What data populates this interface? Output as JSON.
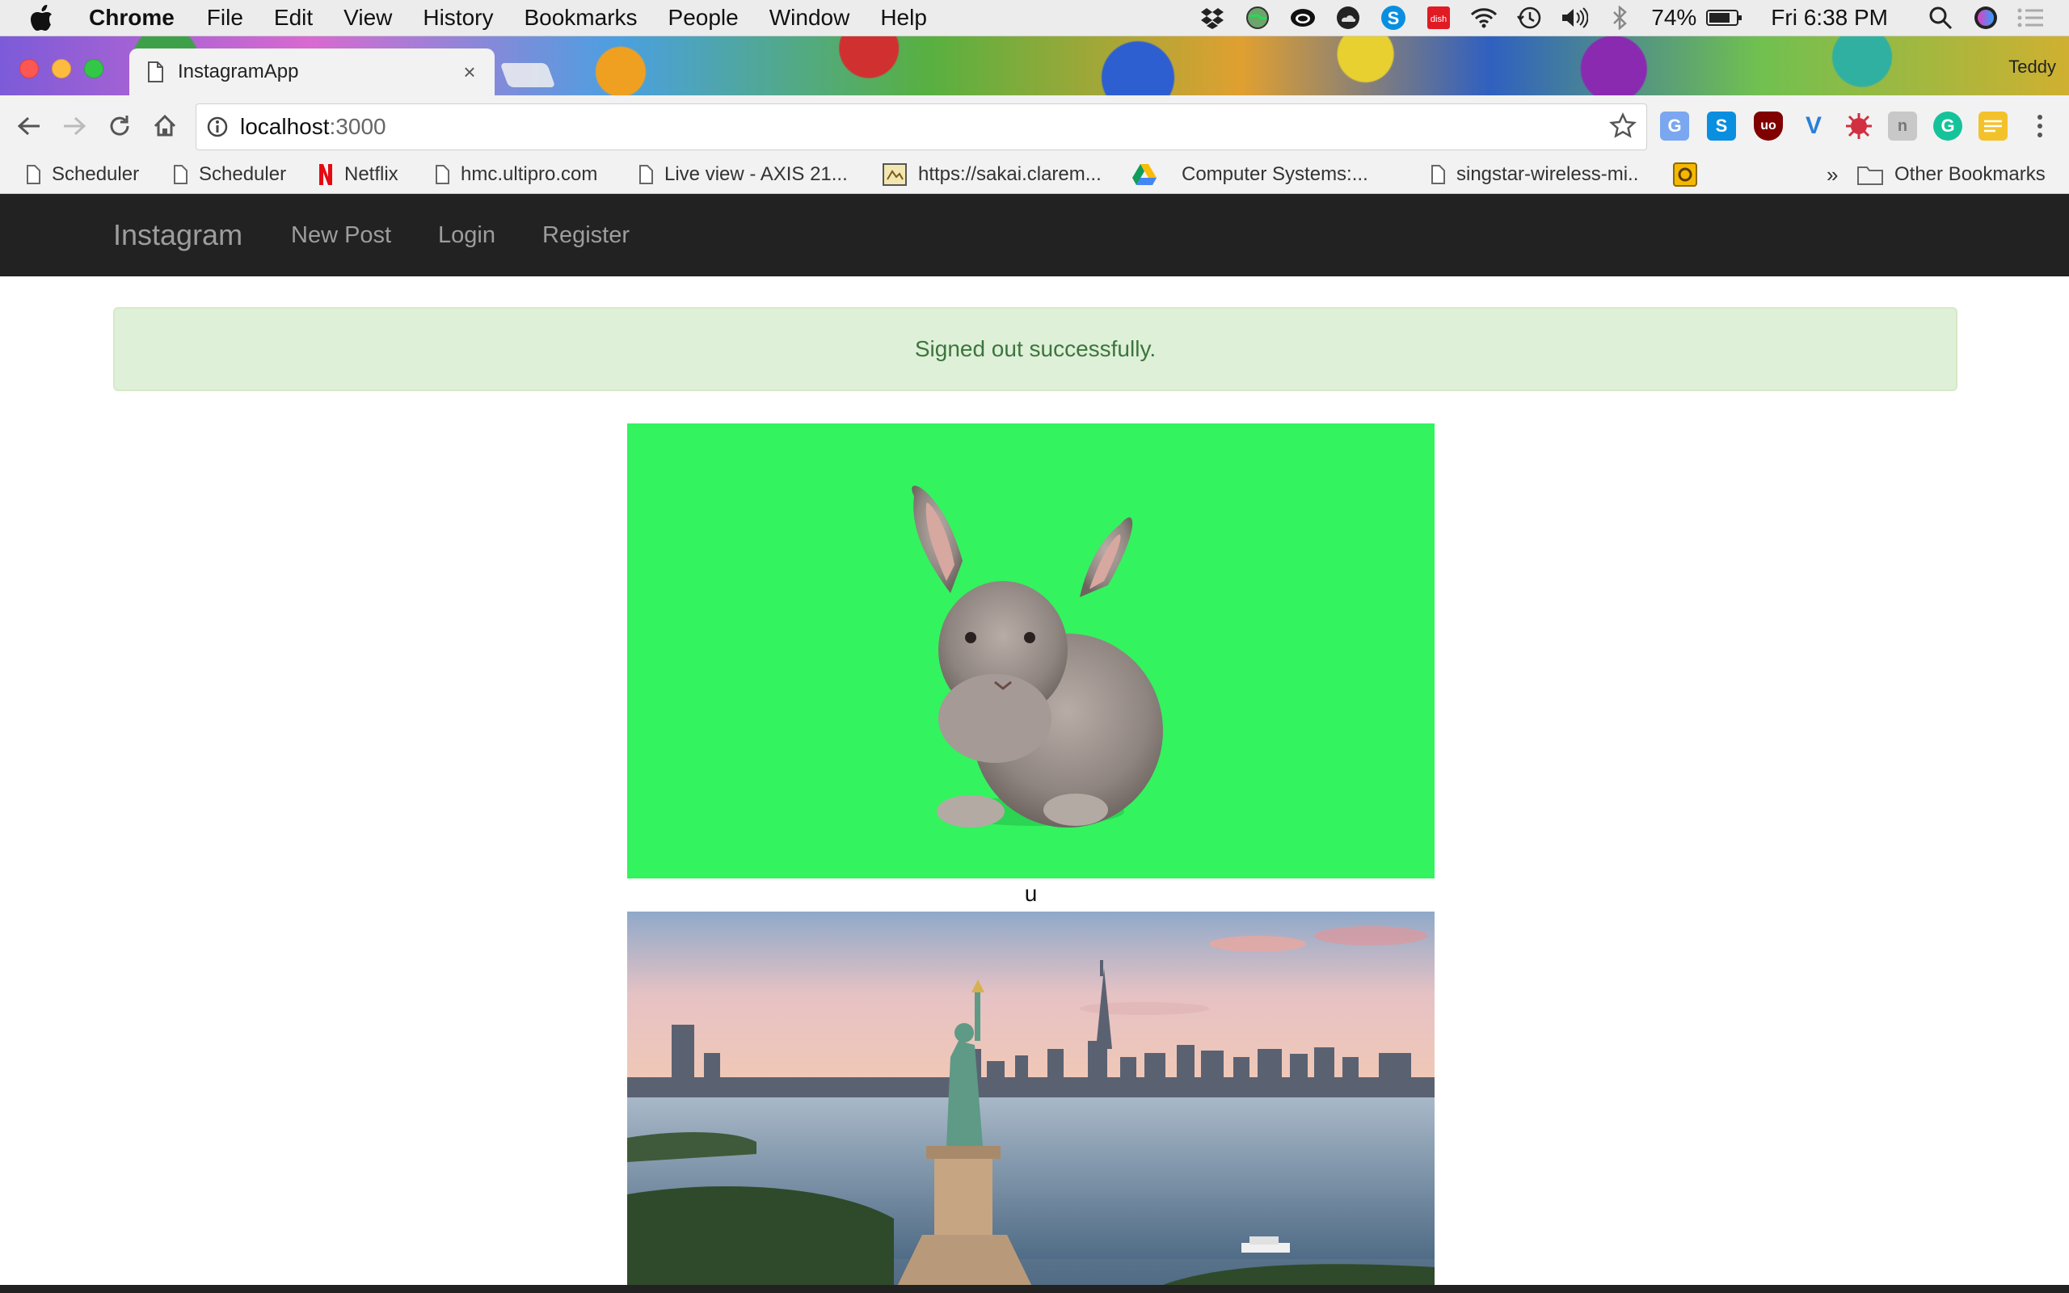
{
  "menubar": {
    "app_name": "Chrome",
    "items": [
      "File",
      "Edit",
      "View",
      "History",
      "Bookmarks",
      "People",
      "Window",
      "Help"
    ],
    "battery_percent": "74%",
    "clock": "Fri 6:38 PM"
  },
  "browser": {
    "tab_title": "InstagramApp",
    "tab_close": "×",
    "profile_name": "Teddy",
    "url_host": "localhost",
    "url_port": ":3000"
  },
  "bookmarks": {
    "items": [
      "Scheduler",
      "Scheduler",
      "Netflix",
      "hmc.ultipro.com",
      "Live view - AXIS 21...",
      "https://sakai.clarem...",
      "Computer Systems:...",
      "singstar-wireless-mi.."
    ],
    "overflow": "»",
    "other": "Other Bookmarks"
  },
  "page": {
    "brand": "Instagram",
    "nav": [
      "New Post",
      "Login",
      "Register"
    ],
    "flash": "Signed out successfully.",
    "posts": [
      {
        "caption": "u",
        "image": "rabbit on green screen"
      },
      {
        "caption": "",
        "image": "statue of liberty and new york skyline"
      }
    ]
  },
  "colors": {
    "navbar_bg": "#222222",
    "nav_text": "#9d9d9d",
    "flash_bg": "#dff0d8",
    "flash_text": "#3c763d",
    "green_screen": "#33f35f"
  },
  "icons": {
    "menubar_left": "apple-icon",
    "status": [
      "dropbox-icon",
      "globe-icon",
      "creative-cloud-icon",
      "cloud-icon",
      "skype-icon",
      "dish-icon",
      "wifi-icon",
      "time-machine-icon",
      "volume-icon",
      "bluetooth-icon",
      "battery-icon",
      "spotlight-icon",
      "siri-icon",
      "notification-center-icon"
    ],
    "extensions": [
      "google-translate-icon",
      "skype-ext-icon",
      "ublock-icon",
      "vimium-icon",
      "bug-icon",
      "plugin-icon",
      "grammarly-icon",
      "note-icon",
      "chrome-menu-icon"
    ]
  }
}
